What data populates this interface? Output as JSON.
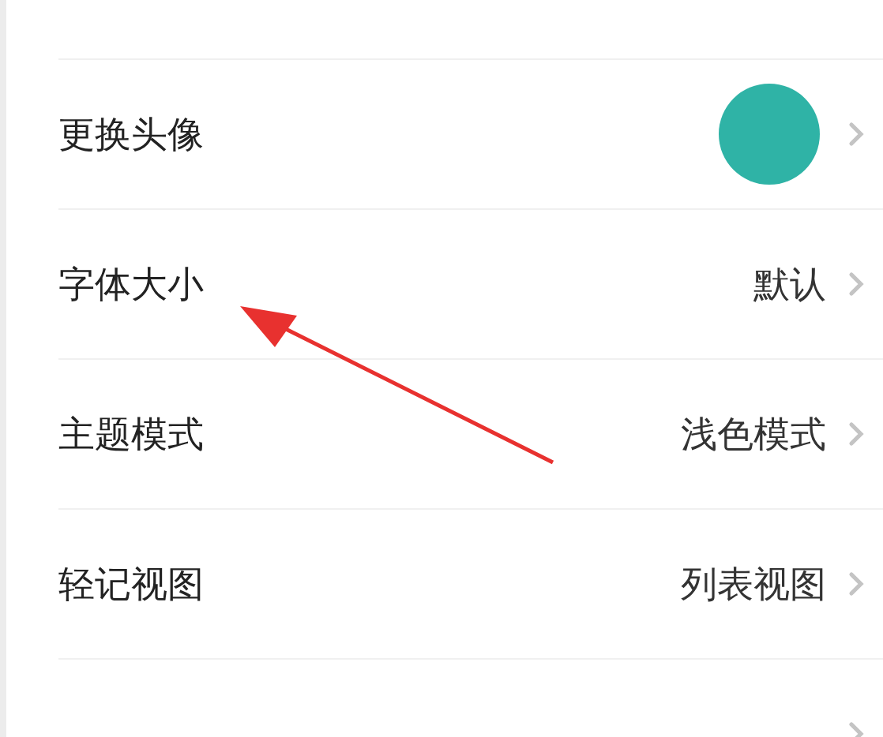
{
  "settings": [
    {
      "kind": "blank"
    },
    {
      "kind": "avatar",
      "label": "更换头像"
    },
    {
      "kind": "text",
      "label": "字体大小",
      "value": "默认"
    },
    {
      "kind": "text",
      "label": "主题模式",
      "value": "浅色模式"
    },
    {
      "kind": "text",
      "label": "轻记视图",
      "value": "列表视图"
    },
    {
      "kind": "text"
    }
  ]
}
